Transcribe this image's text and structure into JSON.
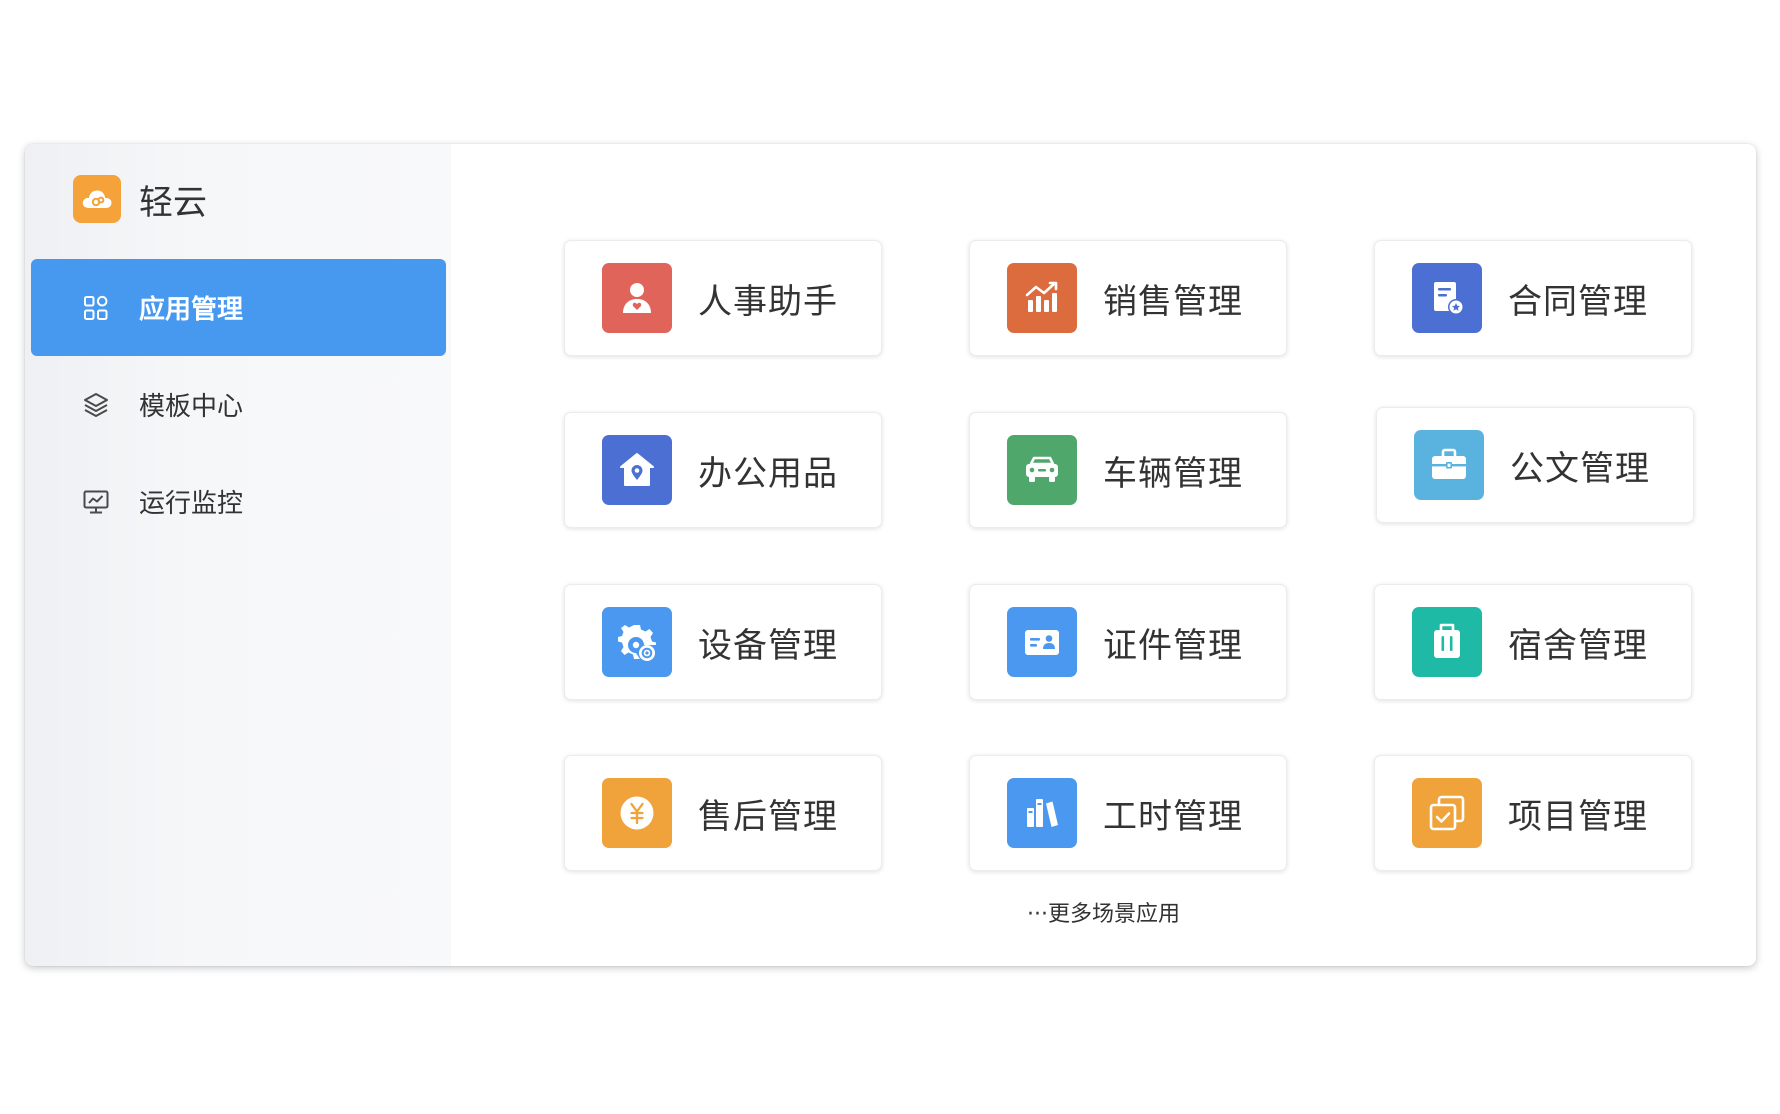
{
  "brand": {
    "name": "轻云",
    "logo_icon": "cloud-icon",
    "logo_color": "#f5a23a"
  },
  "sidebar": {
    "items": [
      {
        "label": "应用管理",
        "icon": "grid-apps-icon",
        "active": true
      },
      {
        "label": "模板中心",
        "icon": "layers-icon",
        "active": false
      },
      {
        "label": "运行监控",
        "icon": "monitor-icon",
        "active": false
      }
    ],
    "active_color": "#4799f0"
  },
  "apps": [
    {
      "label": "人事助手",
      "icon": "person-icon",
      "color": "#e0645a"
    },
    {
      "label": "销售管理",
      "icon": "chart-up-icon",
      "color": "#dc6b3e"
    },
    {
      "label": "合同管理",
      "icon": "contract-icon",
      "color": "#4b6fd3"
    },
    {
      "label": "办公用品",
      "icon": "house-pin-icon",
      "color": "#4b6fd3"
    },
    {
      "label": "车辆管理",
      "icon": "car-icon",
      "color": "#4fa76b"
    },
    {
      "label": "公文管理",
      "icon": "briefcase-icon",
      "color": "#5ab2de"
    },
    {
      "label": "设备管理",
      "icon": "gear-search-icon",
      "color": "#4a98ef"
    },
    {
      "label": "证件管理",
      "icon": "id-card-icon",
      "color": "#4a98ef"
    },
    {
      "label": "宿舍管理",
      "icon": "luggage-icon",
      "color": "#1fbaa6"
    },
    {
      "label": "售后管理",
      "icon": "yen-coin-icon",
      "color": "#f0a23b"
    },
    {
      "label": "工时管理",
      "icon": "books-icon",
      "color": "#4a98ef"
    },
    {
      "label": "项目管理",
      "icon": "checklist-icon",
      "color": "#f0a23b"
    }
  ],
  "more_label": "···更多场景应用"
}
